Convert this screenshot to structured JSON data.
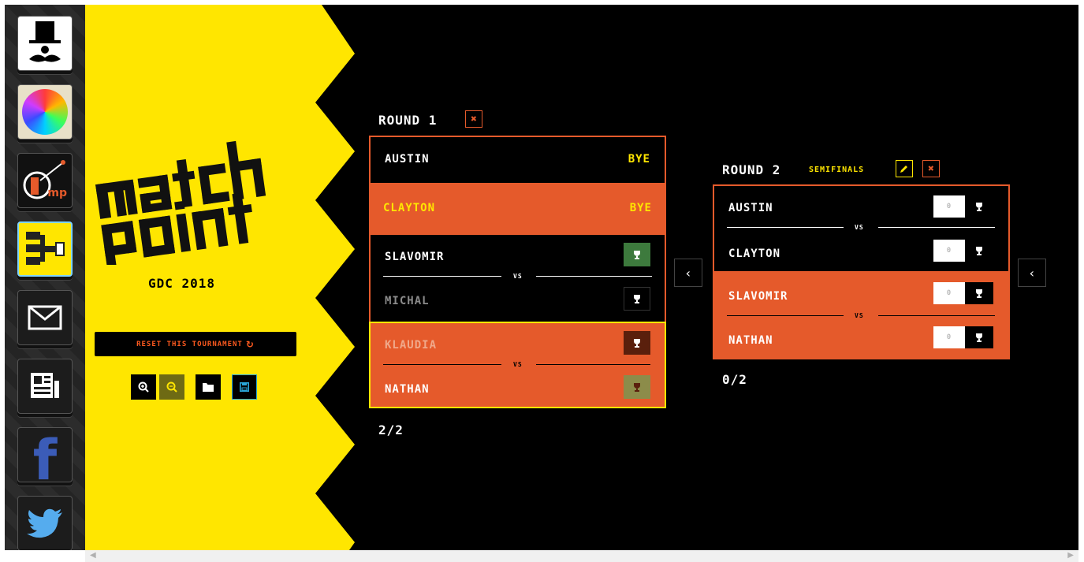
{
  "dock": {
    "items": [
      {
        "name": "top-hat-mustache-app-icon"
      },
      {
        "name": "color-orb-app-icon"
      },
      {
        "name": "mp-app-icon",
        "label": "mp"
      },
      {
        "name": "bracket-app-icon"
      },
      {
        "name": "mail-icon"
      },
      {
        "name": "news-icon"
      },
      {
        "name": "facebook-icon",
        "label": "f"
      },
      {
        "name": "twitter-icon"
      }
    ]
  },
  "sidebar": {
    "event_title": "GDC 2018",
    "reset_label": "RESET THIS TOURNAMENT",
    "tools": [
      "zoom-in-icon",
      "zoom-out-icon",
      "folder-icon",
      "save-icon"
    ]
  },
  "colors": {
    "yellow": "#ffe600",
    "orange": "#e55a2b",
    "black": "#000000",
    "green": "#3d7a3d",
    "olive": "#8c8c4a",
    "brown": "#5a1f0c"
  },
  "rounds": [
    {
      "title": "ROUND 1",
      "progress": "2/2",
      "vs_label": "VS",
      "players": [
        {
          "name": "AUSTIN",
          "status": "BYE"
        },
        {
          "name": "CLAYTON",
          "status": "BYE"
        },
        {
          "name": "SLAVOMIR"
        },
        {
          "name": "MICHAL"
        },
        {
          "name": "KLAUDIA"
        },
        {
          "name": "NATHAN"
        }
      ]
    },
    {
      "title": "ROUND 2",
      "subtitle": "SEMIFINALS",
      "progress": "0/2",
      "vs_label": "VS",
      "players": [
        {
          "name": "AUSTIN",
          "score": "0"
        },
        {
          "name": "CLAYTON",
          "score": "0"
        },
        {
          "name": "SLAVOMIR",
          "score": "0"
        },
        {
          "name": "NATHAN",
          "score": "0"
        }
      ]
    }
  ],
  "nav": {
    "prev_glyph": "‹"
  }
}
